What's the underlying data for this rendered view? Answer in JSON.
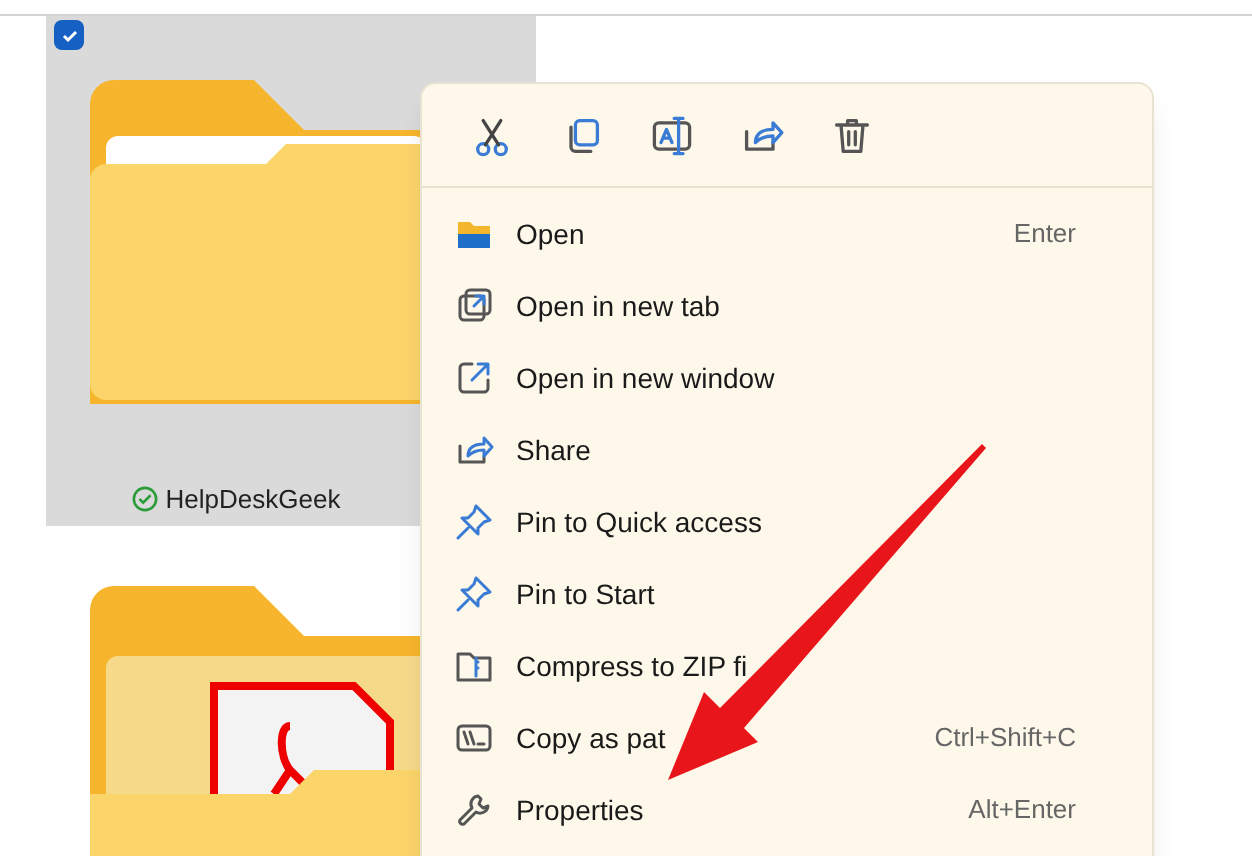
{
  "items": [
    {
      "name": "HelpDeskGeek",
      "selected": true,
      "checked": true,
      "synced": true,
      "kind": "folder"
    },
    {
      "kind": "pdf-folder",
      "selected": false
    }
  ],
  "context_menu": {
    "entries": [
      {
        "label": "Open",
        "shortcut": "Enter"
      },
      {
        "label": "Open in new tab"
      },
      {
        "label": "Open in new window"
      },
      {
        "label": "Share"
      },
      {
        "label": "Pin to Quick access"
      },
      {
        "label": "Pin to Start"
      },
      {
        "label": "Compress to ZIP fi"
      },
      {
        "label": "Copy as pat",
        "shortcut": "Ctrl+Shift+C"
      },
      {
        "label": "Properties",
        "shortcut": "Alt+Enter"
      }
    ]
  }
}
